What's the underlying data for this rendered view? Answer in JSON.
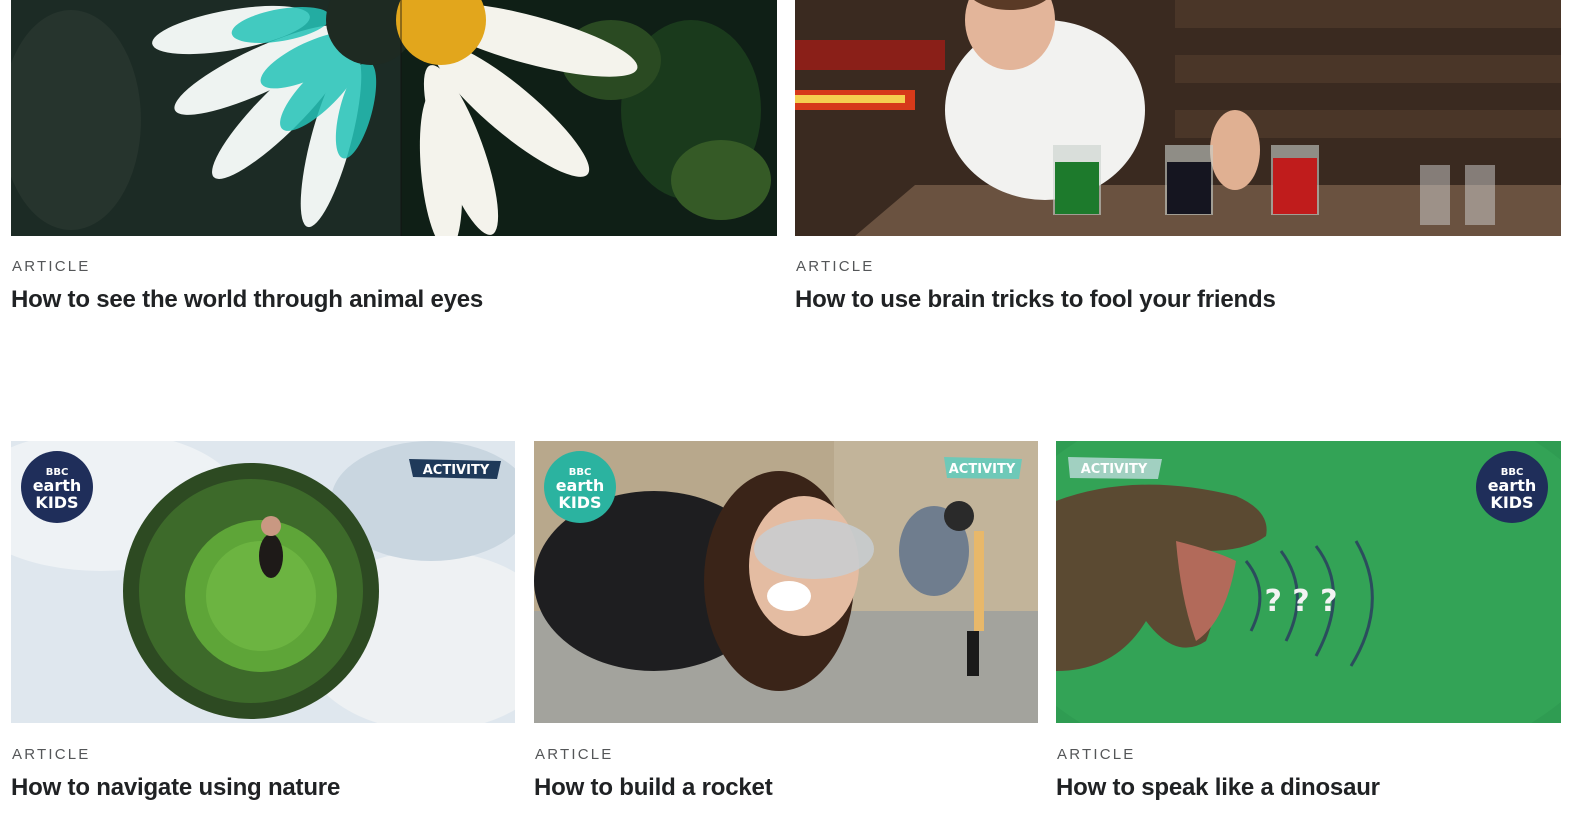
{
  "cards": [
    {
      "kicker": "ARTICLE",
      "title": "How to see the world through animal eyes",
      "image": "daisy split teal and white"
    },
    {
      "kicker": "ARTICLE",
      "title": "How to use brain tricks to fool your friends",
      "image": "man looking at coloured cups"
    },
    {
      "kicker": "ARTICLE",
      "title": "How to navigate using nature",
      "image": "tiny planet with woman",
      "logo_lines": [
        "BBC",
        "earth",
        "KIDS"
      ],
      "tag": "ACTIVITY"
    },
    {
      "kicker": "ARTICLE",
      "title": "How to build a rocket",
      "image": "woman in goggles, bottle rocket",
      "logo_lines": [
        "BBC",
        "earth",
        "KIDS"
      ],
      "tag": "ACTIVITY"
    },
    {
      "kicker": "ARTICLE",
      "title": "How to speak like a dinosaur",
      "image": "t-rex roaring on green background",
      "logo_lines": [
        "BBC",
        "earth",
        "KIDS"
      ],
      "tag": "ACTIVITY",
      "question_marks": "? ? ?"
    }
  ],
  "colors": {
    "title": "#202224",
    "kicker": "#545658",
    "teal_logo": "#2bb3a0",
    "navy_logo": "#1f2e5a",
    "green_screen": "#2f9c52"
  }
}
